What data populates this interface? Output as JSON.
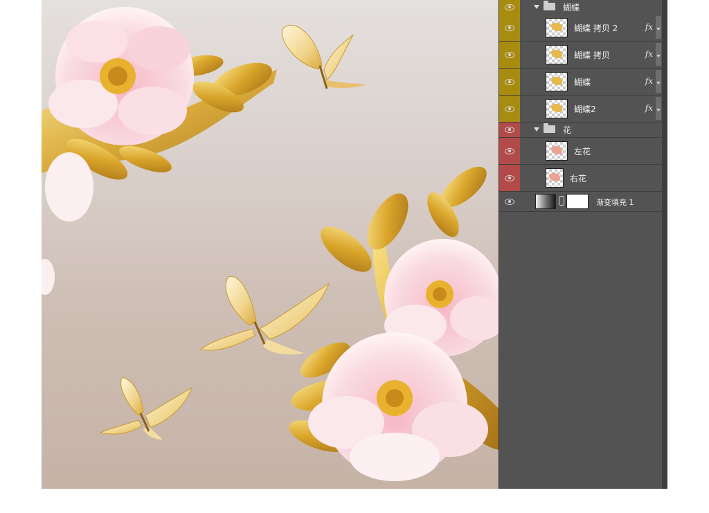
{
  "layers_panel": {
    "rows": [
      {
        "label": "蝴蝶",
        "kind": "group",
        "eye": "yellow"
      },
      {
        "label": "蝴蝶 拷贝 2",
        "kind": "layer",
        "eye": "yellow",
        "fx": "fx"
      },
      {
        "label": "蝴蝶 拷贝",
        "kind": "layer",
        "eye": "yellow",
        "fx": "fx"
      },
      {
        "label": "蝴蝶",
        "kind": "layer",
        "eye": "yellow",
        "fx": "fx"
      },
      {
        "label": "蝴蝶2",
        "kind": "layer",
        "eye": "yellow",
        "fx": "fx"
      },
      {
        "label": "花",
        "kind": "group",
        "eye": "red"
      },
      {
        "label": "左花",
        "kind": "layer",
        "eye": "red"
      },
      {
        "label": "右花",
        "kind": "layer",
        "eye": "red"
      },
      {
        "label": "渐变填充 1",
        "kind": "fill",
        "eye": "none"
      }
    ]
  },
  "colors": {
    "group_butterfly": "#a88c10",
    "group_flower": "#b24a4a",
    "panel_bg": "#535353",
    "gold": "#d9a92a",
    "pink": "#f3c6cf"
  },
  "icons": [
    "eye-icon",
    "folder-icon",
    "disclosure-triangle-icon",
    "fx-icon",
    "chain-link-icon"
  ]
}
